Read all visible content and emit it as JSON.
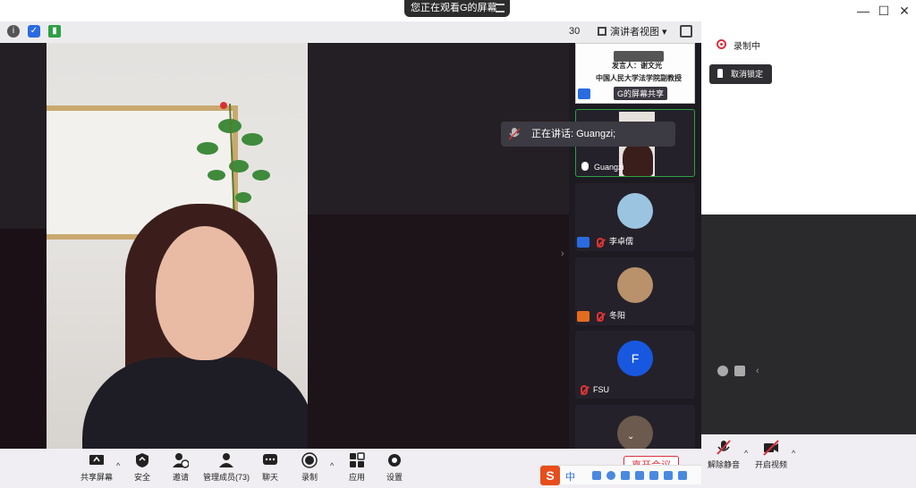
{
  "window": {
    "viewing_banner": "您正在观看G的屏幕",
    "controls": [
      "minimize",
      "maximize",
      "close"
    ]
  },
  "topbar": {
    "count": "30",
    "view_mode": "演讲者视图"
  },
  "share_tile": {
    "presenter_line": "发言人：谢文光",
    "title_line": "中国人民大学法学院副教授",
    "caption": "G的屏幕共享"
  },
  "speaking_toast": "正在讲话: Guangzi;",
  "participants": [
    {
      "name": "Guangzi",
      "type": "video"
    },
    {
      "name": "李卓儒",
      "type": "avatar",
      "color": "#9bc4e0"
    },
    {
      "name": "冬阳",
      "type": "avatar",
      "color": "#b9916a"
    },
    {
      "name": "FSU",
      "type": "initial",
      "initial": "F",
      "color": "#1858e0"
    }
  ],
  "right_panel": {
    "recording": "录制中",
    "unpin": "取消锁定"
  },
  "toolbar": {
    "share_screen": "共享屏幕",
    "security": "安全",
    "invite": "邀请",
    "manage_members": "管理成员(73)",
    "chat": "聊天",
    "record": "录制",
    "apps": "应用",
    "settings": "设置",
    "leave": "离开会议",
    "unmute": "解除静音",
    "start_video": "开启视频"
  },
  "ime": {
    "lang": "中"
  },
  "colors": {
    "accent_red": "#d9313f",
    "accent_blue": "#2a6be0",
    "speaker_green": "#2ea043"
  }
}
